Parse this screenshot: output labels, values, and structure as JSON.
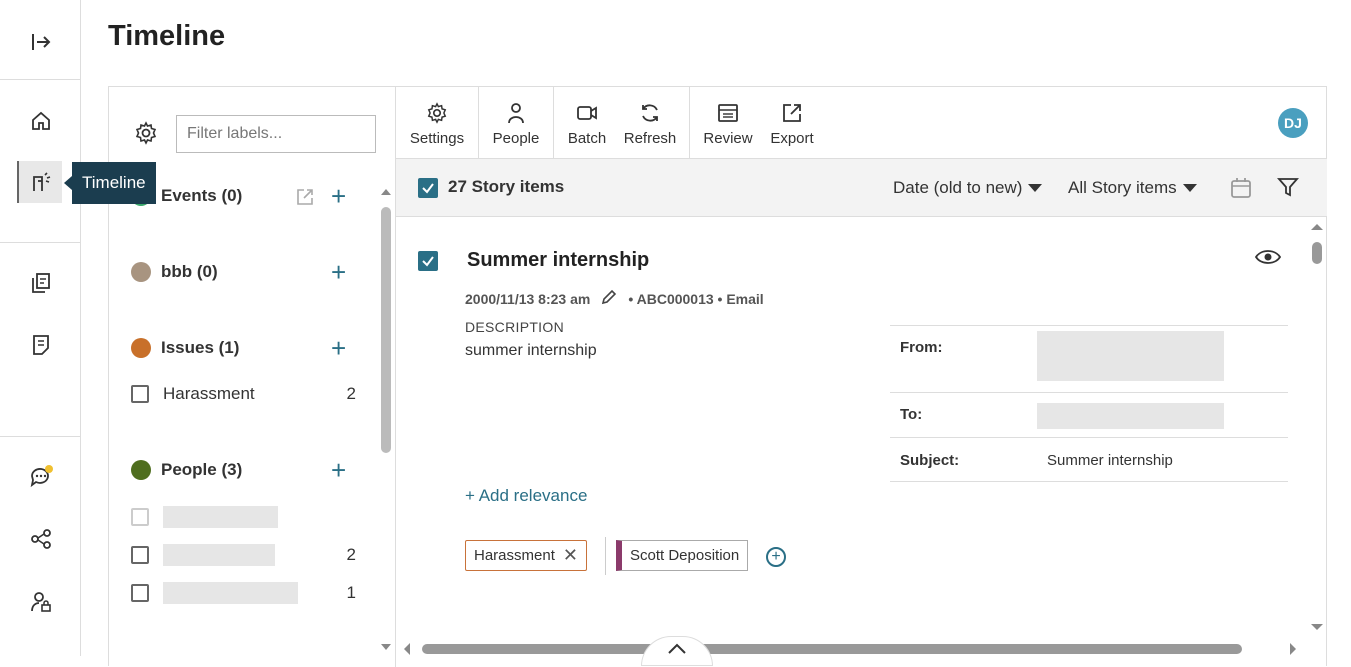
{
  "page": {
    "title": "Timeline"
  },
  "nav": {
    "tooltip": "Timeline"
  },
  "labels_panel": {
    "filter_placeholder": "Filter labels...",
    "groups": [
      {
        "name": "Events (0)",
        "color": "#3aa86b"
      },
      {
        "name": "bbb (0)",
        "color": "#a89480"
      },
      {
        "name": "Issues (1)",
        "color": "#c8702a"
      },
      {
        "name": "People (3)",
        "color": "#4f6e1f"
      }
    ],
    "issues_items": [
      {
        "label": "Harassment",
        "count": "2"
      }
    ],
    "people_items": [
      {
        "count": ""
      },
      {
        "count": "2"
      },
      {
        "count": "1"
      }
    ]
  },
  "toolbar": {
    "settings": "Settings",
    "people": "People",
    "batch": "Batch",
    "refresh": "Refresh",
    "review": "Review",
    "export": "Export",
    "avatar": "DJ"
  },
  "list": {
    "count_label": "27 Story items",
    "sort": "Date (old to new)",
    "filter": "All Story items"
  },
  "item": {
    "title": "Summer internship",
    "date": "2000/11/13 8:23 am",
    "meta": "• ABC000013 • Email",
    "description_label": "DESCRIPTION",
    "description": "summer internship",
    "add_relevance": "+ Add relevance",
    "tags": [
      "Harassment"
    ],
    "story": "Scott Deposition",
    "email": {
      "from_label": "From:",
      "to_label": "To:",
      "subject_label": "Subject:",
      "subject": "Summer internship"
    }
  },
  "colors": {
    "accent": "#2a6f86",
    "tooltip_bg": "#1b3d4f",
    "issue_tag": "#c8723a",
    "story_tag": "#8b3a6b"
  }
}
